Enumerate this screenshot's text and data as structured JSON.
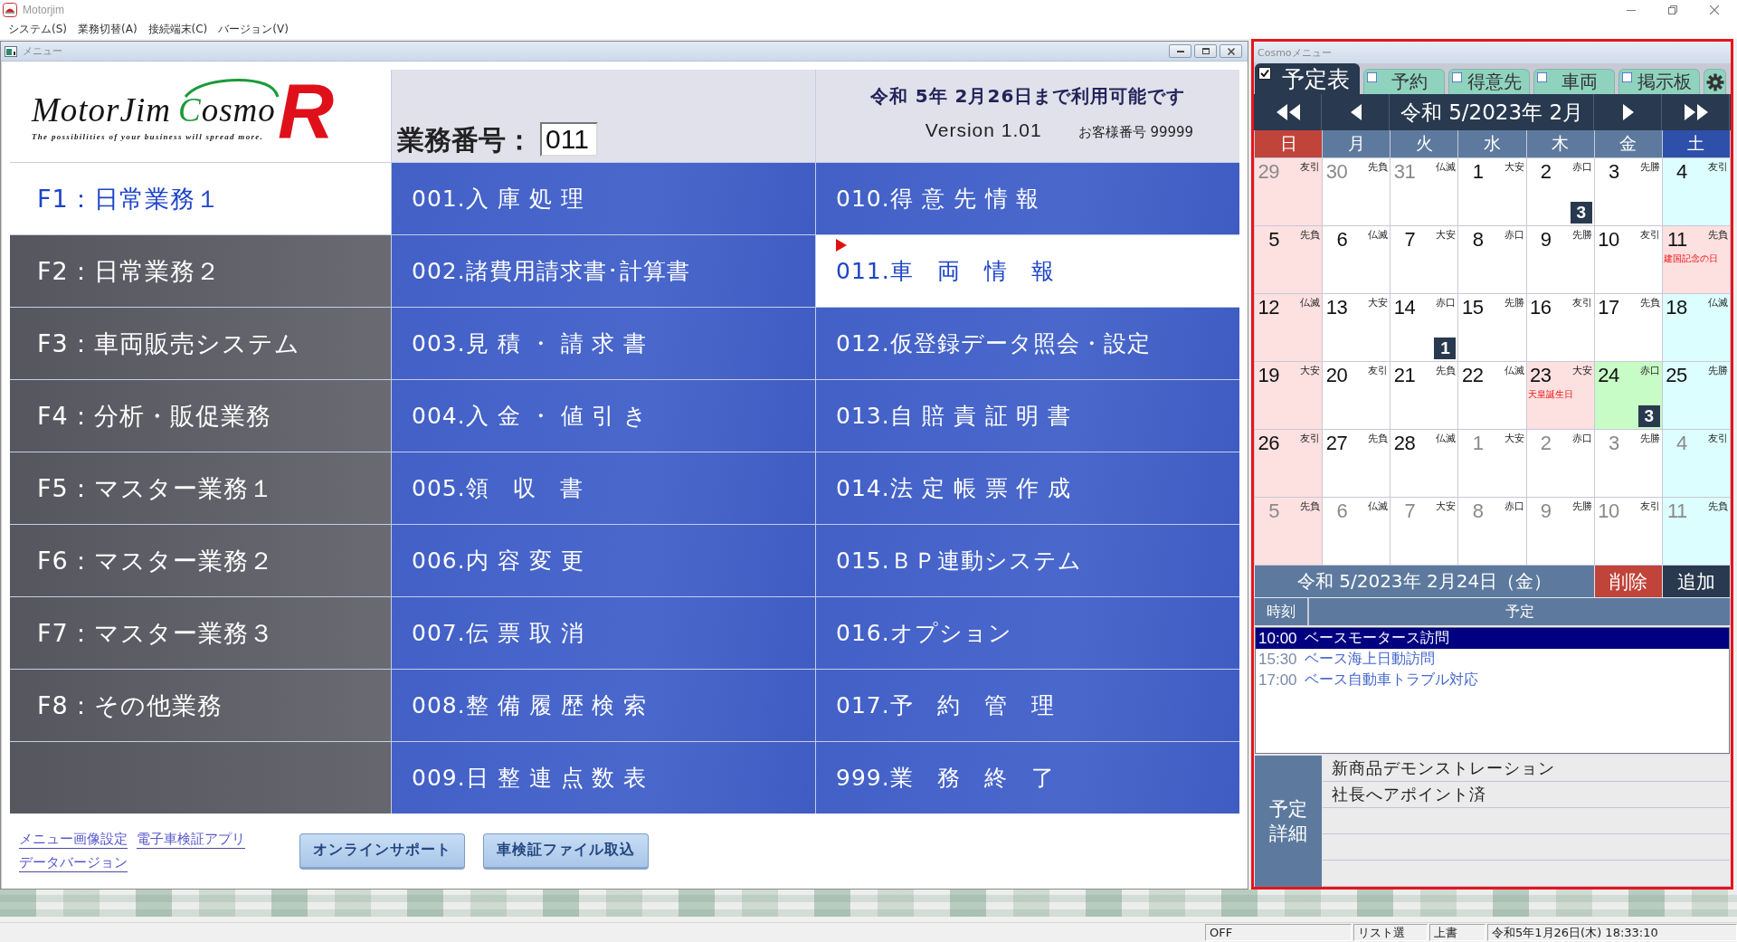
{
  "app_window": {
    "title": "Motorjim"
  },
  "menu_bar": [
    "システム(S)",
    "業務切替(A)",
    "接続端末(C)",
    "バージョン(V)"
  ],
  "menu_window": {
    "title": "メニュー",
    "logo": {
      "brand": "MotorJim",
      "product": "Cosmo",
      "mark": "R",
      "tagline": "The possibilities of your business will spread more."
    },
    "business_number": {
      "label": "業務番号：",
      "value": "011"
    },
    "license_notice": "令和 5年 2月26日まで利用可能です",
    "version": "Version 1.01",
    "customer_number": "お客様番号 99999",
    "categories": [
      {
        "label": "F1：日常業務１",
        "selected": true
      },
      {
        "label": "F2：日常業務２",
        "selected": false
      },
      {
        "label": "F3：車両販売システム",
        "selected": false
      },
      {
        "label": "F4：分析・販促業務",
        "selected": false
      },
      {
        "label": "F5：マスター業務１",
        "selected": false
      },
      {
        "label": "F6：マスター業務２",
        "selected": false
      },
      {
        "label": "F7：マスター業務３",
        "selected": false
      },
      {
        "label": "F8：その他業務",
        "selected": false
      }
    ],
    "task_columns": [
      {
        "items": [
          {
            "label": "001.入 庫 処 理",
            "selected": false
          },
          {
            "label": "002.諸費用請求書･計算書",
            "selected": false
          },
          {
            "label": "003.見 積 ・ 請 求 書",
            "selected": false
          },
          {
            "label": "004.入 金 ・ 値 引 き",
            "selected": false
          },
          {
            "label": "005.領　収　書",
            "selected": false
          },
          {
            "label": "006.内 容 変 更",
            "selected": false
          },
          {
            "label": "007.伝 票 取 消",
            "selected": false
          },
          {
            "label": "008.整 備 履 歴 検 索",
            "selected": false
          },
          {
            "label": "009.日 整 連 点 数 表",
            "selected": false
          }
        ]
      },
      {
        "items": [
          {
            "label": "010.得 意 先 情 報",
            "selected": false
          },
          {
            "label": "011.車　両　情　報",
            "selected": true
          },
          {
            "label": "012.仮登録データ照会・設定",
            "selected": false
          },
          {
            "label": "013.自 賠 責 証 明 書",
            "selected": false
          },
          {
            "label": "014.法 定 帳 票 作 成",
            "selected": false
          },
          {
            "label": "015.ＢＰ連動システム",
            "selected": false
          },
          {
            "label": "016.オプション",
            "selected": false
          },
          {
            "label": "017.予　約　管　理",
            "selected": false
          },
          {
            "label": "999.業　務　終　了",
            "selected": false
          }
        ]
      }
    ],
    "links": [
      "メニュー画像設定",
      "電子車検証アプリ",
      "データバージョン"
    ],
    "buttons": [
      "オンラインサポート",
      "車検証ファイル取込"
    ]
  },
  "cosmo_window": {
    "title": "Cosmoメニュー",
    "tabs": [
      {
        "label": "予定表",
        "selected": true,
        "checked": true
      },
      {
        "label": "予約",
        "selected": false,
        "checked": false
      },
      {
        "label": "得意先",
        "selected": false,
        "checked": false
      },
      {
        "label": "車両",
        "selected": false,
        "checked": false
      },
      {
        "label": "掲示板",
        "selected": false,
        "checked": false
      }
    ],
    "calendar": {
      "title": "令和 5/2023年 2月",
      "weekdays": [
        "日",
        "月",
        "火",
        "水",
        "木",
        "金",
        "土"
      ],
      "weeks": [
        {
          "days": [
            {
              "day": "29",
              "rokuyo": "友引",
              "in_month": false,
              "selected": false
            },
            {
              "day": "30",
              "rokuyo": "先負",
              "in_month": false,
              "selected": false
            },
            {
              "day": "31",
              "rokuyo": "仏滅",
              "in_month": false,
              "selected": false
            },
            {
              "day": "1",
              "rokuyo": "大安",
              "in_month": true,
              "selected": false
            },
            {
              "day": "2",
              "rokuyo": "赤口",
              "in_month": true,
              "selected": false,
              "count": "3"
            },
            {
              "day": "3",
              "rokuyo": "先勝",
              "in_month": true,
              "selected": false
            },
            {
              "day": "4",
              "rokuyo": "友引",
              "in_month": true,
              "selected": false
            }
          ]
        },
        {
          "days": [
            {
              "day": "5",
              "rokuyo": "先負",
              "in_month": true,
              "selected": false
            },
            {
              "day": "6",
              "rokuyo": "仏滅",
              "in_month": true,
              "selected": false
            },
            {
              "day": "7",
              "rokuyo": "大安",
              "in_month": true,
              "selected": false
            },
            {
              "day": "8",
              "rokuyo": "赤口",
              "in_month": true,
              "selected": false
            },
            {
              "day": "9",
              "rokuyo": "先勝",
              "in_month": true,
              "selected": false
            },
            {
              "day": "10",
              "rokuyo": "友引",
              "in_month": true,
              "selected": false
            },
            {
              "day": "11",
              "rokuyo": "先負",
              "in_month": true,
              "selected": false,
              "holiday": "建国記念の日"
            }
          ]
        },
        {
          "days": [
            {
              "day": "12",
              "rokuyo": "仏滅",
              "in_month": true,
              "selected": false
            },
            {
              "day": "13",
              "rokuyo": "大安",
              "in_month": true,
              "selected": false
            },
            {
              "day": "14",
              "rokuyo": "赤口",
              "in_month": true,
              "selected": false,
              "count": "1"
            },
            {
              "day": "15",
              "rokuyo": "先勝",
              "in_month": true,
              "selected": false
            },
            {
              "day": "16",
              "rokuyo": "友引",
              "in_month": true,
              "selected": false
            },
            {
              "day": "17",
              "rokuyo": "先負",
              "in_month": true,
              "selected": false
            },
            {
              "day": "18",
              "rokuyo": "仏滅",
              "in_month": true,
              "selected": false
            }
          ]
        },
        {
          "days": [
            {
              "day": "19",
              "rokuyo": "大安",
              "in_month": true,
              "selected": false
            },
            {
              "day": "20",
              "rokuyo": "友引",
              "in_month": true,
              "selected": false
            },
            {
              "day": "21",
              "rokuyo": "先負",
              "in_month": true,
              "selected": false
            },
            {
              "day": "22",
              "rokuyo": "仏滅",
              "in_month": true,
              "selected": false
            },
            {
              "day": "23",
              "rokuyo": "大安",
              "in_month": true,
              "selected": false,
              "holiday": "天皇誕生日"
            },
            {
              "day": "24",
              "rokuyo": "赤口",
              "in_month": true,
              "selected": true,
              "count": "3"
            },
            {
              "day": "25",
              "rokuyo": "先勝",
              "in_month": true,
              "selected": false
            }
          ]
        },
        {
          "days": [
            {
              "day": "26",
              "rokuyo": "友引",
              "in_month": true,
              "selected": false
            },
            {
              "day": "27",
              "rokuyo": "先負",
              "in_month": true,
              "selected": false
            },
            {
              "day": "28",
              "rokuyo": "仏滅",
              "in_month": true,
              "selected": false
            },
            {
              "day": "1",
              "rokuyo": "大安",
              "in_month": false,
              "selected": false
            },
            {
              "day": "2",
              "rokuyo": "赤口",
              "in_month": false,
              "selected": false
            },
            {
              "day": "3",
              "rokuyo": "先勝",
              "in_month": false,
              "selected": false
            },
            {
              "day": "4",
              "rokuyo": "友引",
              "in_month": false,
              "selected": false
            }
          ]
        },
        {
          "days": [
            {
              "day": "5",
              "rokuyo": "先負",
              "in_month": false,
              "selected": false
            },
            {
              "day": "6",
              "rokuyo": "仏滅",
              "in_month": false,
              "selected": false
            },
            {
              "day": "7",
              "rokuyo": "大安",
              "in_month": false,
              "selected": false
            },
            {
              "day": "8",
              "rokuyo": "赤口",
              "in_month": false,
              "selected": false
            },
            {
              "day": "9",
              "rokuyo": "先勝",
              "in_month": false,
              "selected": false
            },
            {
              "day": "10",
              "rokuyo": "友引",
              "in_month": false,
              "selected": false
            },
            {
              "day": "11",
              "rokuyo": "先負",
              "in_month": false,
              "selected": false
            }
          ]
        }
      ]
    },
    "date_bar": {
      "label": "令和 5/2023年 2月24日（金）",
      "delete_button": "削除",
      "add_button": "追加"
    },
    "schedule": {
      "columns": [
        "時刻",
        "予定"
      ],
      "items": [
        {
          "time": "10:00",
          "title": "ベースモータース訪問",
          "selected": true
        },
        {
          "time": "15:30",
          "title": "ベース海上日動訪問",
          "selected": false
        },
        {
          "time": "17:00",
          "title": "ベース自動車トラブル対応",
          "selected": false
        }
      ]
    },
    "details": {
      "label": "予定詳細",
      "lines": [
        "新商品デモンストレーション",
        "社長へアポイント済"
      ]
    }
  },
  "status_bar": [
    "OFF",
    "リスト選",
    "上書",
    "令和5年1月26日(木) 18:33:10"
  ]
}
